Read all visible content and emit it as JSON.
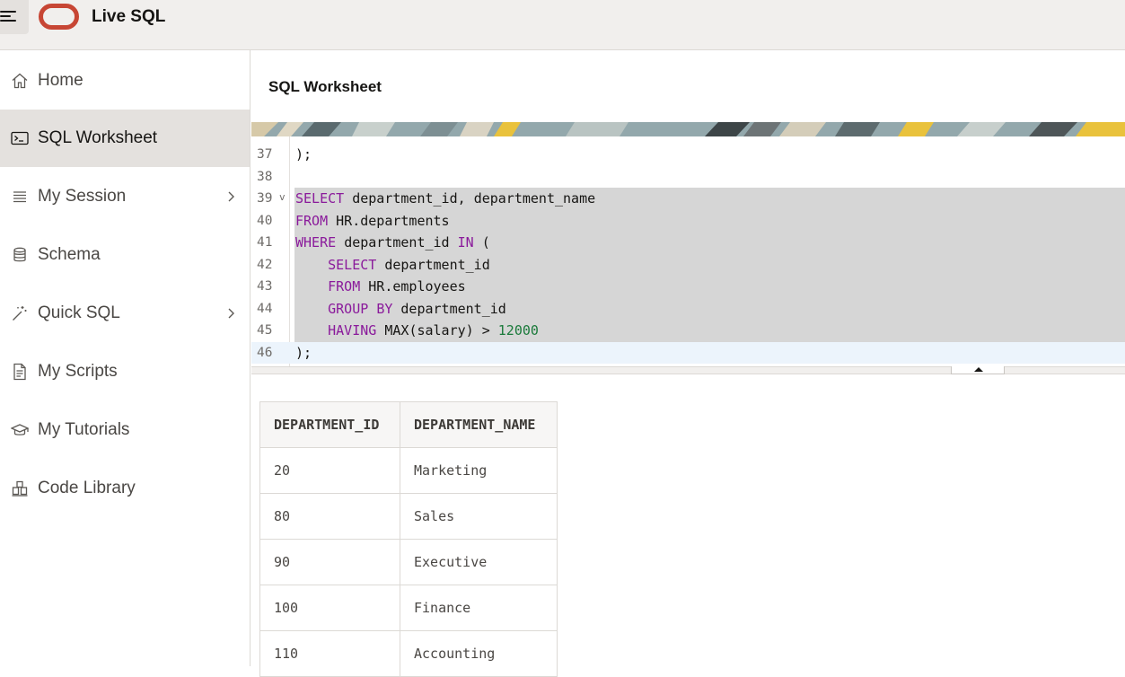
{
  "app": {
    "title": "Live SQL"
  },
  "sidebar": {
    "items": [
      {
        "label": "Home",
        "icon": "home-icon"
      },
      {
        "label": "SQL Worksheet",
        "icon": "terminal-icon",
        "active": true
      },
      {
        "label": "My Session",
        "icon": "list-icon",
        "has_submenu": true
      },
      {
        "label": "Schema",
        "icon": "database-icon"
      },
      {
        "label": "Quick SQL",
        "icon": "magic-wand-icon",
        "has_submenu": true
      },
      {
        "label": "My Scripts",
        "icon": "document-icon"
      },
      {
        "label": "My Tutorials",
        "icon": "graduation-cap-icon"
      },
      {
        "label": "Code Library",
        "icon": "library-icon"
      }
    ]
  },
  "main": {
    "title": "SQL Worksheet"
  },
  "editor": {
    "lines": [
      {
        "no": "37",
        "text": ");"
      },
      {
        "no": "38",
        "text": ""
      },
      {
        "no": "39",
        "text": "SELECT department_id, department_name",
        "fold": "v"
      },
      {
        "no": "40",
        "text": "FROM HR.departments"
      },
      {
        "no": "41",
        "text": "WHERE department_id IN ("
      },
      {
        "no": "42",
        "text": "    SELECT department_id"
      },
      {
        "no": "43",
        "text": "    FROM HR.employees"
      },
      {
        "no": "44",
        "text": "    GROUP BY department_id"
      },
      {
        "no": "45",
        "text": "    HAVING MAX(salary) > 12000"
      },
      {
        "no": "46",
        "text": ");"
      }
    ]
  },
  "results": {
    "columns": [
      "DEPARTMENT_ID",
      "DEPARTMENT_NAME"
    ],
    "rows": [
      [
        "20",
        "Marketing"
      ],
      [
        "80",
        "Sales"
      ],
      [
        "90",
        "Executive"
      ],
      [
        "100",
        "Finance"
      ],
      [
        "110",
        "Accounting"
      ]
    ]
  },
  "colors": {
    "brand": "#c74634",
    "keyword": "#8a1a9b",
    "number": "#1b7a3b",
    "selection": "#d6d6d6"
  }
}
